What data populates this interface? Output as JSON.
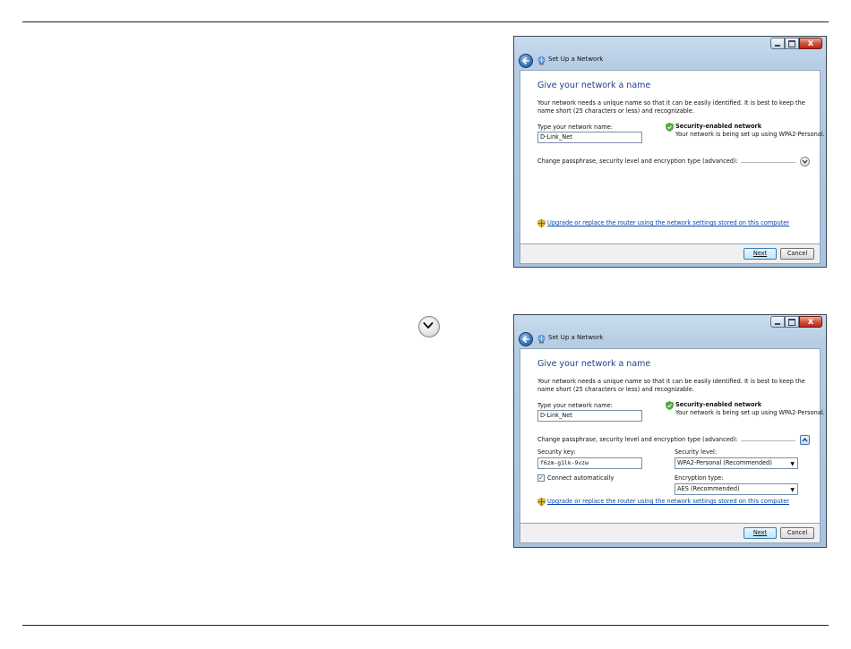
{
  "window": {
    "title": "Set Up a Network",
    "close_glyph": "x"
  },
  "wizard": {
    "heading": "Give your network a name",
    "description": "Your network needs a unique name so that it can be easily identified. It is best to keep the name short (25 characters or less) and recognizable.",
    "name_label": "Type your network name:",
    "name_value": "D-Link_Net",
    "security_title": "Security-enabled network",
    "security_desc": "Your network is being set up using WPA2-Personal.",
    "change_label": "Change passphrase, security level and encryption type (advanced):",
    "upgrade_link": "Upgrade or replace the router using the network settings stored on this computer",
    "next_label": "Next",
    "cancel_label": "Cancel"
  },
  "advanced": {
    "security_key_label": "Security key:",
    "security_key_value": "f6zm-g1lk-9vzw",
    "security_level_label": "Security level:",
    "security_level_value": "WPA2-Personal (Recommended)",
    "connect_auto_label": "Connect automatically",
    "connect_auto_checked": true,
    "encryption_label": "Encryption type:",
    "encryption_value": "AES (Recommended)"
  },
  "icons": {
    "page_expand": "chevron-down-icon",
    "back": "back-arrow-icon",
    "wizard": "network-icon",
    "shield": "shield-icon",
    "upgrade": "shield-icon"
  },
  "colors": {
    "heading": "#1e3f8a",
    "link": "#0645ad",
    "close_button": "#c8412b"
  }
}
